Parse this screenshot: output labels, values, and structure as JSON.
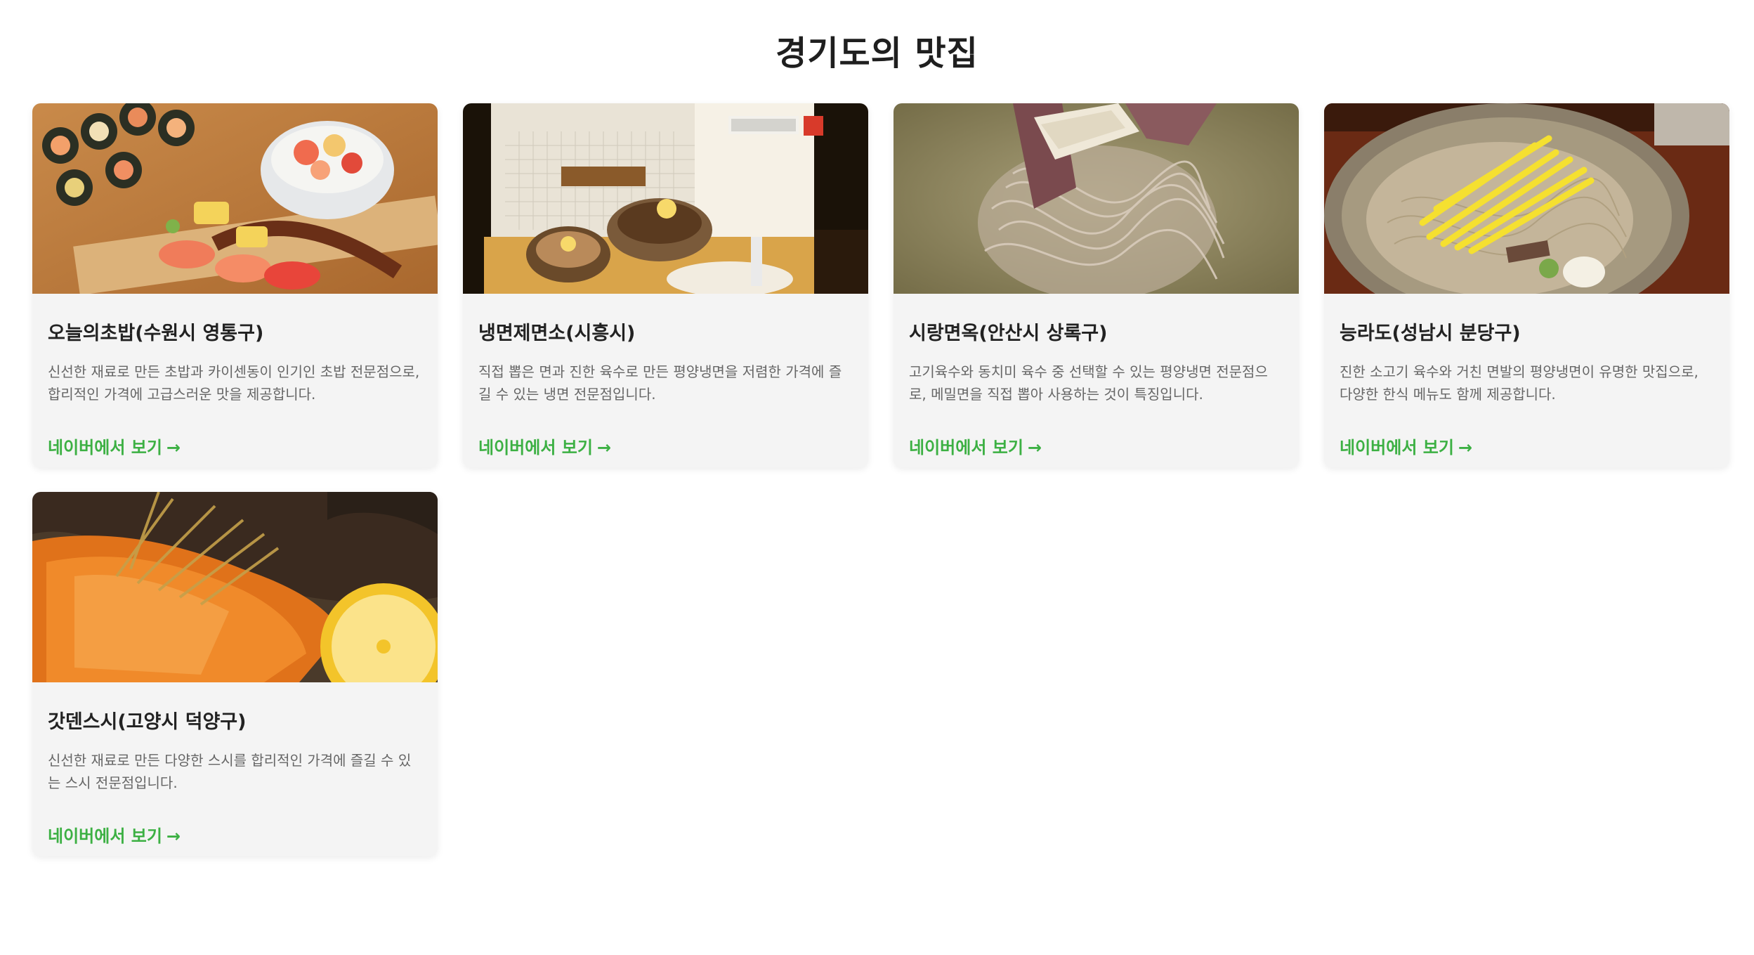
{
  "page": {
    "title": "경기도의 맛집"
  },
  "colors": {
    "link": "#3cb043",
    "card_bg": "#f4f4f4",
    "title": "#1f1f1f",
    "desc": "#666666"
  },
  "restaurants": [
    {
      "name": "오늘의초밥(수원시 영통구)",
      "description": "신선한 재료로 만든 초밥과 카이센동이 인기인 초밥 전문점으로, 합리적인 가격에 고급스러운 맛을 제공합니다.",
      "link_label": "네이버에서 보기",
      "link_arrow": "→",
      "image": "sushi-platter-photo"
    },
    {
      "name": "냉면제면소(시흥시)",
      "description": "직접 뽑은 면과 진한 육수로 만든 평양냉면을 저렴한 가격에 즐길 수 있는 냉면 전문점입니다.",
      "link_label": "네이버에서 보기",
      "link_arrow": "→",
      "image": "naengmyeon-shop-photo"
    },
    {
      "name": "시랑면옥(안산시 상록구)",
      "description": "고기육수와 동치미 육수 중 선택할 수 있는 평양냉면 전문점으로, 메밀면을 직접 뽑아 사용하는 것이 특징입니다.",
      "link_label": "네이버에서 보기",
      "link_arrow": "→",
      "image": "cold-noodle-broth-photo"
    },
    {
      "name": "능라도(성남시 분당구)",
      "description": "진한 소고기 육수와 거친 면발의 평양냉면이 유명한 맛집으로, 다양한 한식 메뉴도 함께 제공합니다.",
      "link_label": "네이버에서 보기",
      "link_arrow": "→",
      "image": "naengmyeon-bowl-photo"
    },
    {
      "name": "갓덴스시(고양시 덕양구)",
      "description": "신선한 재료로 만든 다양한 스시를 합리적인 가격에 즐길 수 있는 스시 전문점입니다.",
      "link_label": "네이버에서 보기",
      "link_arrow": "→",
      "image": "seared-salmon-photo"
    }
  ]
}
